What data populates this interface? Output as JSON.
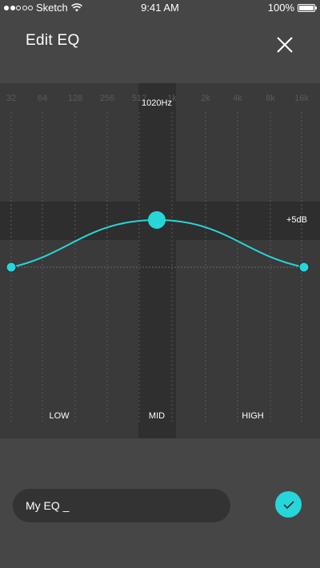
{
  "status_bar": {
    "carrier": "Sketch",
    "time": "9:41 AM",
    "battery": "100%",
    "battery_level": 1.0,
    "signal_bars": 2
  },
  "header": {
    "title": "Edit EQ",
    "close_icon": "close-icon"
  },
  "eq": {
    "frequencies": [
      "32",
      "64",
      "128",
      "256",
      "512",
      "1k",
      "2k",
      "4k",
      "8k",
      "16k"
    ],
    "selected_frequency": "1020Hz",
    "gain_label": "+5dB",
    "bands": [
      "LOW",
      "MID",
      "HIGH"
    ],
    "accent_color": "#26d6d9",
    "selected_band": "MID"
  },
  "name_input": {
    "value": "My EQ _"
  },
  "confirm": {
    "icon": "check-icon"
  }
}
